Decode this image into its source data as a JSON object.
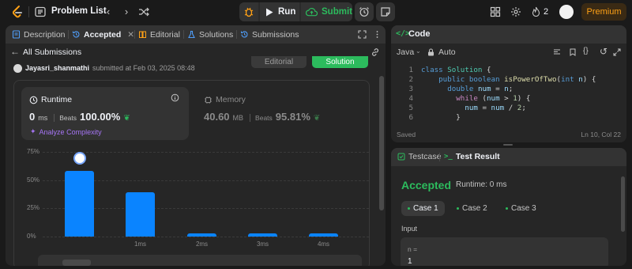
{
  "topbar": {
    "problem_list_label": "Problem List",
    "run_label": "Run",
    "submit_label": "Submit",
    "streak_count": "2",
    "premium_label": "Premium"
  },
  "left_panel": {
    "tabs": [
      {
        "label": "Description"
      },
      {
        "label": "Accepted"
      },
      {
        "label": "Editorial"
      },
      {
        "label": "Solutions"
      },
      {
        "label": "Submissions"
      }
    ],
    "back_label": "All Submissions",
    "submission": {
      "user": "Jayasri_shanmathi",
      "submitted_text": "submitted at Feb 03, 2025 08:48"
    },
    "editorial_button": "Editorial",
    "solution_button": "Solution",
    "runtime": {
      "title": "Runtime",
      "value": "0",
      "unit": "ms",
      "beats_label": "Beats",
      "beats_value": "100.00%",
      "analyze_label": "Analyze Complexity"
    },
    "memory": {
      "title": "Memory",
      "value": "40.60",
      "unit": "MB",
      "beats_label": "Beats",
      "beats_value": "95.81%"
    }
  },
  "chart_data": {
    "type": "bar",
    "categories": [
      "0ms",
      "1ms",
      "2ms",
      "3ms",
      "4ms"
    ],
    "tick_labels_shown": [
      "",
      "1ms",
      "2ms",
      "3ms",
      "4ms"
    ],
    "values": [
      58,
      39,
      2,
      2,
      2
    ],
    "yticks": [
      "75%",
      "50%",
      "25%",
      "0%"
    ],
    "ylim": [
      0,
      75
    ],
    "highlight_index": 0,
    "grid": true
  },
  "code_panel": {
    "title": "Code",
    "language": "Java",
    "auto_label": "Auto",
    "lines": [
      {
        "n": "1",
        "tokens": [
          [
            "kw",
            "class "
          ],
          [
            "cls",
            "Solution"
          ],
          [
            "op",
            " {"
          ]
        ]
      },
      {
        "n": "2",
        "tokens": [
          [
            "op",
            "    "
          ],
          [
            "kw",
            "public boolean "
          ],
          [
            "fn",
            "isPowerOfTwo"
          ],
          [
            "op",
            "("
          ],
          [
            "kw",
            "int "
          ],
          [
            "var",
            "n"
          ],
          [
            "op",
            ") {"
          ]
        ]
      },
      {
        "n": "3",
        "tokens": [
          [
            "op",
            "      "
          ],
          [
            "kw",
            "double "
          ],
          [
            "var",
            "num"
          ],
          [
            "op",
            " = "
          ],
          [
            "var",
            "n"
          ],
          [
            "op",
            ";"
          ]
        ]
      },
      {
        "n": "4",
        "tokens": [
          [
            "op",
            "        "
          ],
          [
            "ctrl",
            "while"
          ],
          [
            "op",
            " ("
          ],
          [
            "var",
            "num"
          ],
          [
            "op",
            " > "
          ],
          [
            "num",
            "1"
          ],
          [
            "op",
            ") {"
          ]
        ]
      },
      {
        "n": "5",
        "tokens": [
          [
            "op",
            "          "
          ],
          [
            "var",
            "num"
          ],
          [
            "op",
            " = "
          ],
          [
            "var",
            "num"
          ],
          [
            "op",
            " / "
          ],
          [
            "num",
            "2"
          ],
          [
            "op",
            ";"
          ]
        ]
      },
      {
        "n": "6",
        "tokens": [
          [
            "op",
            "        }"
          ]
        ]
      }
    ],
    "status_saved": "Saved",
    "cursor_pos": "Ln 10, Col 22"
  },
  "result_panel": {
    "testcase_tab": "Testcase",
    "result_tab": "Test Result",
    "status": "Accepted",
    "runtime_text": "Runtime: 0 ms",
    "cases": [
      "Case 1",
      "Case 2",
      "Case 3"
    ],
    "input_label": "Input",
    "input_var": "n =",
    "input_value": "1"
  },
  "colors": {
    "accent_green": "#2cbb5d",
    "bar_blue": "#0a84ff",
    "premium_orange": "#ffa116",
    "analyze_purple": "#a675f5"
  }
}
